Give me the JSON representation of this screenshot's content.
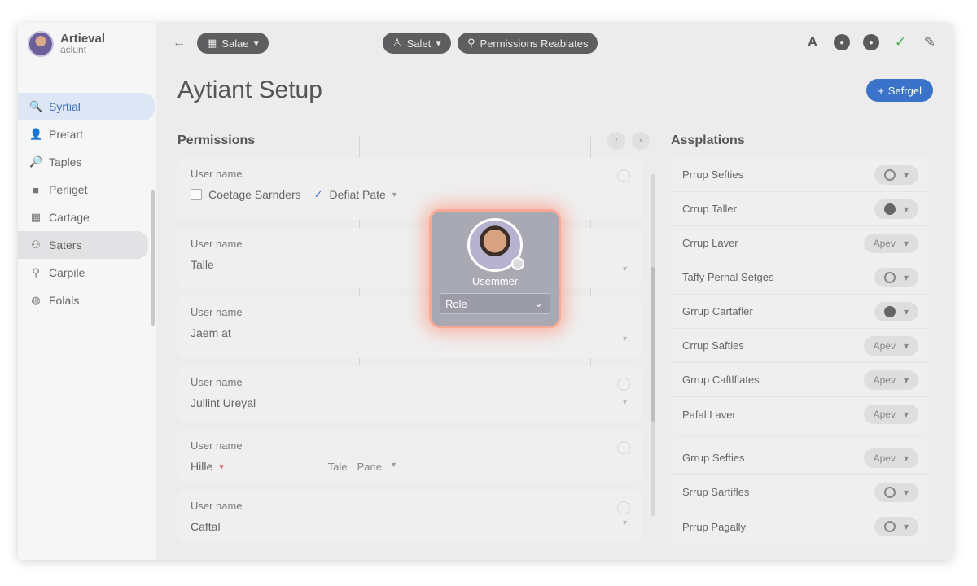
{
  "account": {
    "name": "Artieval",
    "sub": "aclunt"
  },
  "sidebar": {
    "items": [
      {
        "label": "Syrtial",
        "icon": "search-icon",
        "glyph": "🔍"
      },
      {
        "label": "Pretart",
        "icon": "person-icon",
        "glyph": "👤"
      },
      {
        "label": "Taples",
        "icon": "search-icon",
        "glyph": "🔎"
      },
      {
        "label": "Perliget",
        "icon": "briefcase-icon",
        "glyph": "■"
      },
      {
        "label": "Cartage",
        "icon": "calendar-icon",
        "glyph": "▦"
      },
      {
        "label": "Saters",
        "icon": "users-icon",
        "glyph": "⚇"
      },
      {
        "label": "Carpile",
        "icon": "wrench-icon",
        "glyph": "⚲"
      },
      {
        "label": "Folals",
        "icon": "globe-icon",
        "glyph": "◍"
      }
    ]
  },
  "topbar": {
    "back_glyph": "←",
    "pill_left": "Salae",
    "pill_mid": "Salet",
    "pill_search": "Permissions Reablates"
  },
  "header": {
    "title": "Aytiant Setup",
    "primary_button": "Sefrgel"
  },
  "permissions": {
    "title": "Permissions",
    "rows": [
      {
        "label": "User name",
        "value": "Coetage Sarnders",
        "extra": "Defiat Pate"
      },
      {
        "label": "User name",
        "value": "Talle"
      },
      {
        "label": "User name",
        "value": "Jaem at"
      },
      {
        "label": "User name",
        "value": "Jullint Ureyal"
      },
      {
        "label": "User name",
        "value": "Hille",
        "tag1": "Tale",
        "tag2": "Pane"
      },
      {
        "label": "User name",
        "value": "Caftal"
      }
    ]
  },
  "popup": {
    "name": "Usemmer",
    "select_value": "Role"
  },
  "assignments": {
    "title": "Assplations",
    "groups": [
      [
        {
          "label": "Prrup Sefties",
          "chip": ""
        },
        {
          "label": "Crrup Taller",
          "chip": ""
        },
        {
          "label": "Crrup Laver",
          "chip": "Apev"
        },
        {
          "label": "Taffy Pernal Setges",
          "chip": ""
        },
        {
          "label": "Grrup Cartafler",
          "chip": ""
        },
        {
          "label": "Crrup Safties",
          "chip": "Apev"
        },
        {
          "label": "Grrup Caftlfiates",
          "chip": "Apev"
        },
        {
          "label": "Pafal Laver",
          "chip": "Apev"
        }
      ],
      [
        {
          "label": "Grrup Sefties",
          "chip": "Apev"
        },
        {
          "label": "Srrup Sartifles",
          "chip": ""
        },
        {
          "label": "Prrup Pagally",
          "chip": ""
        }
      ]
    ]
  }
}
